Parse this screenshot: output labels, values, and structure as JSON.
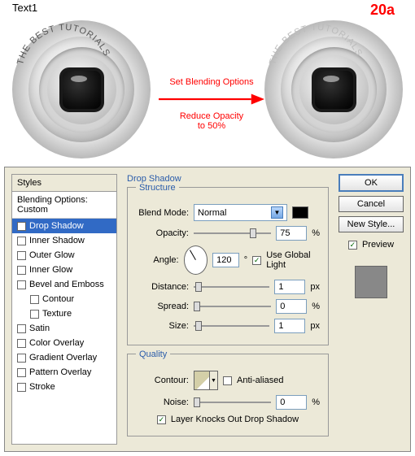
{
  "top": {
    "label": "Text1",
    "code": "20a",
    "ringText": "THE BEST TUTORIALS",
    "annot1": "Set Blending Options",
    "annot2": "Reduce Opacity",
    "annot3": "to 50%"
  },
  "styles": {
    "header": "Styles",
    "sub": "Blending Options: Custom",
    "items": [
      {
        "label": "Drop Shadow",
        "checked": true,
        "sel": true
      },
      {
        "label": "Inner Shadow",
        "checked": false
      },
      {
        "label": "Outer Glow",
        "checked": false
      },
      {
        "label": "Inner Glow",
        "checked": false
      },
      {
        "label": "Bevel and Emboss",
        "checked": false
      },
      {
        "label": "Contour",
        "checked": false,
        "indent": true
      },
      {
        "label": "Texture",
        "checked": false,
        "indent": true
      },
      {
        "label": "Satin",
        "checked": false
      },
      {
        "label": "Color Overlay",
        "checked": false
      },
      {
        "label": "Gradient Overlay",
        "checked": false
      },
      {
        "label": "Pattern Overlay",
        "checked": false
      },
      {
        "label": "Stroke",
        "checked": false
      }
    ]
  },
  "panel": {
    "title": "Drop Shadow",
    "structure": "Structure",
    "blendMode": "Blend Mode:",
    "blendModeVal": "Normal",
    "opacity": "Opacity:",
    "opacityVal": "75",
    "angle": "Angle:",
    "angleVal": "120",
    "deg": "°",
    "useGlobal": "Use Global Light",
    "distance": "Distance:",
    "distanceVal": "1",
    "spread": "Spread:",
    "spreadVal": "0",
    "size": "Size:",
    "sizeVal": "1",
    "pct": "%",
    "px": "px",
    "quality": "Quality",
    "contour": "Contour:",
    "antiAliased": "Anti-aliased",
    "noise": "Noise:",
    "noiseVal": "0",
    "knockout": "Layer Knocks Out Drop Shadow"
  },
  "buttons": {
    "ok": "OK",
    "cancel": "Cancel",
    "newStyle": "New Style...",
    "preview": "Preview"
  }
}
